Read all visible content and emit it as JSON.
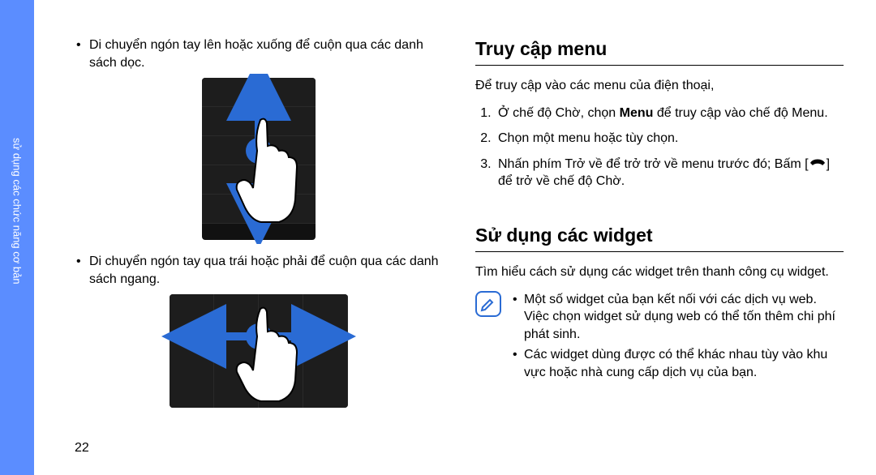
{
  "sidebar": {
    "label": "sử dụng các chức năng cơ bản"
  },
  "left": {
    "bullet1": "Di chuyển ngón tay lên hoặc xuống để cuộn qua các danh sách dọc.",
    "bullet2": "Di chuyển ngón tay qua trái hoặc phải để cuộn qua các danh sách ngang."
  },
  "right": {
    "heading1": "Truy cập menu",
    "intro1": "Để truy cập vào các menu của điện thoại,",
    "steps": [
      {
        "pre": "Ở chế độ Chờ, chọn ",
        "bold": "Menu",
        "post": " để truy cập vào chế độ Menu."
      },
      {
        "pre": "Chọn một menu hoặc tùy chọn.",
        "bold": "",
        "post": ""
      },
      {
        "pre": "Nhấn phím Trở về để trở trở về menu trước đó; Bấm [",
        "bold": "",
        "post": "] để trở về chế độ Chờ.",
        "icon": true
      }
    ],
    "heading2": "Sử dụng các widget",
    "intro2": "Tìm hiểu cách sử dụng các widget trên thanh công cụ widget.",
    "notes": [
      "Một số widget của bạn kết nối với các dịch vụ web. Việc chọn widget sử dụng web có thể tốn thêm chi phí phát sinh.",
      "Các widget dùng được có thể khác nhau tùy vào khu vực hoặc nhà cung cấp dịch vụ của bạn."
    ]
  },
  "page_number": "22",
  "icons": {
    "note": "✎",
    "end_call": "end-call-icon"
  }
}
